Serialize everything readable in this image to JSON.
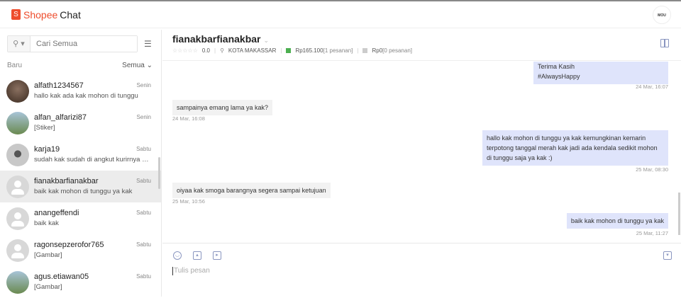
{
  "header": {
    "brand": "Shopee",
    "chat": "Chat",
    "logo_letter": "S",
    "profile_badge": "MOU"
  },
  "sidebar": {
    "search_placeholder": "Cari Semua",
    "filter_left": "Baru",
    "filter_right": "Semua ⌄",
    "items": [
      {
        "name": "alfath1234567",
        "preview": "hallo kak ada kak mohon di tunggu",
        "day": "Senin"
      },
      {
        "name": "alfan_alfarizi87",
        "preview": "[Stiker]",
        "day": "Senin"
      },
      {
        "name": "karja19",
        "preview": "sudah kak sudah di angkut kurirnya m...",
        "day": "Sabtu"
      },
      {
        "name": "fianakbarfianakbar",
        "preview": "baik kak mohon di tunggu ya kak",
        "day": "Sabtu"
      },
      {
        "name": "anangeffendi",
        "preview": "baik kak",
        "day": "Sabtu"
      },
      {
        "name": "ragonsepzerofor765",
        "preview": "[Gambar]",
        "day": "Sabtu"
      },
      {
        "name": "agus.etiawan05",
        "preview": "[Gambar]",
        "day": "Sabtu"
      }
    ]
  },
  "chat": {
    "name": "fianakbarfianakbar",
    "rating_stars": "☆☆☆☆☆",
    "rating": "0.0",
    "city": "KOTA MAKASSAR",
    "paid_amount": "Rp165.100",
    "paid_orders": "[1 pesanan]",
    "unpaid_amount": "Rp0",
    "unpaid_orders": "[0 pesanan]",
    "messages": [
      {
        "dir": "sent",
        "text": "Terima Kasih\n#AlwaysHappy",
        "time": "24 Mar, 16:07"
      },
      {
        "dir": "received",
        "text": "sampainya emang lama ya kak?",
        "time": "24 Mar, 16:08"
      },
      {
        "dir": "sent",
        "text": "hallo kak mohon di tunggu ya kak kemungkinan kemarin terpotong tanggal merah kak jadi ada kendala sedikit mohon di tunggu saja ya kak :)",
        "time": "25 Mar, 08:30"
      },
      {
        "dir": "received",
        "text": "oiyaa kak smoga barangnya segera sampai ketujuan",
        "time": "25 Mar, 10:56"
      },
      {
        "dir": "sent",
        "text": "baik kak mohon di tunggu ya kak",
        "time": "25 Mar, 11:27"
      }
    ],
    "input_placeholder": "Tulis pesan"
  }
}
